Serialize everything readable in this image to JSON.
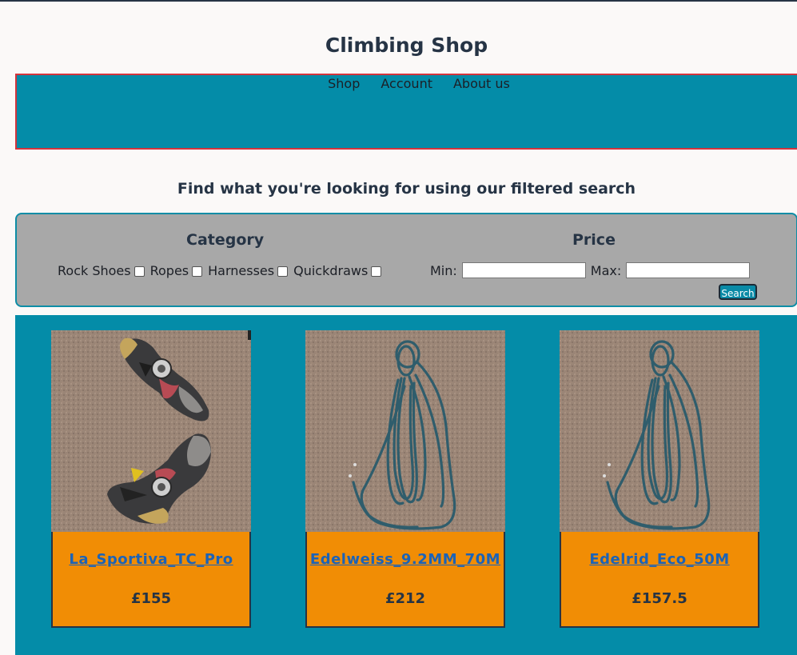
{
  "site": {
    "title": "Climbing Shop"
  },
  "nav": {
    "items": [
      {
        "label": "Shop"
      },
      {
        "label": "Account"
      },
      {
        "label": "About us"
      }
    ]
  },
  "search": {
    "heading": "Find what you're looking for using our filtered search",
    "category_title": "Category",
    "price_title": "Price",
    "categories": [
      {
        "label": "Rock Shoes",
        "checked": false
      },
      {
        "label": "Ropes",
        "checked": false
      },
      {
        "label": "Harnesses",
        "checked": false
      },
      {
        "label": "Quickdraws",
        "checked": false
      }
    ],
    "min_label": "Min:",
    "min_value": "",
    "max_label": "Max:",
    "max_value": "",
    "button_label": "Search"
  },
  "products": [
    {
      "name": "La_Sportiva_TC_Pro",
      "price": "£155",
      "image": "climbing-shoes-photo"
    },
    {
      "name": "Edelweiss_9.2MM_70M",
      "price": "£212",
      "image": "rope-photo"
    },
    {
      "name": "Edelrid_Eco_50M",
      "price": "£157.5",
      "image": "rope-photo"
    }
  ],
  "colors": {
    "nav_bg": "#048ca8",
    "nav_border": "#d4343c",
    "filter_bg": "#a8a8a8",
    "card_bg": "#f18d05",
    "link": "#1b63b8",
    "text": "#263445"
  }
}
